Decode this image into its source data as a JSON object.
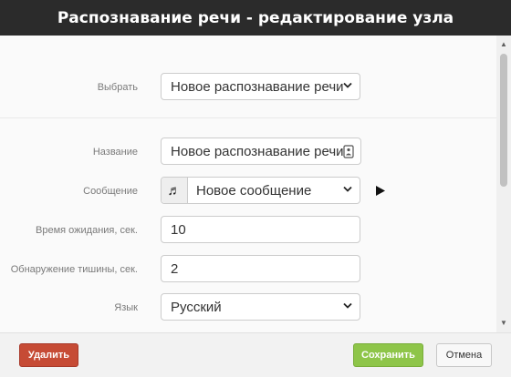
{
  "dialog": {
    "title": "Распознавание речи - редактирование узла"
  },
  "form": {
    "select": {
      "label": "Выбрать",
      "value": "Новое распознавание речи"
    },
    "name": {
      "label": "Название",
      "value": "Новое распознавание речи"
    },
    "message": {
      "label": "Сообщение",
      "value": "Новое сообщение",
      "icon": "music-note-icon"
    },
    "timeout": {
      "label": "Время ожидания, сек.",
      "value": "10"
    },
    "silence": {
      "label": "Обнаружение тишины, сек.",
      "value": "2"
    },
    "language": {
      "label": "Язык",
      "value": "Русский"
    }
  },
  "footer": {
    "delete_label": "Удалить",
    "save_label": "Сохранить",
    "cancel_label": "Отмена"
  },
  "colors": {
    "titlebar": "#2b2b2b",
    "delete": "#c64b35",
    "save": "#8ec549"
  }
}
